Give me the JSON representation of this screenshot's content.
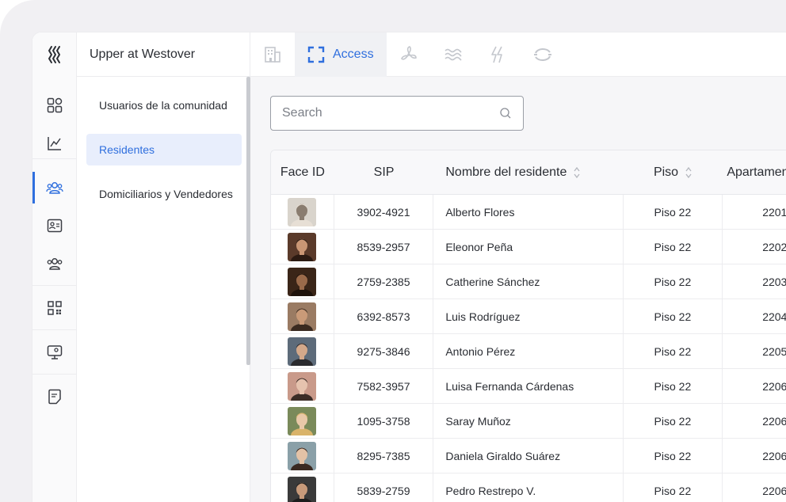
{
  "app": {
    "site_name": "Upper at Westover"
  },
  "top_tabs": [
    {
      "icon": "building-icon",
      "label": ""
    },
    {
      "icon": "scan-icon",
      "label": "Access"
    },
    {
      "icon": "fan-icon",
      "label": ""
    },
    {
      "icon": "waves-icon",
      "label": ""
    },
    {
      "icon": "bolt-icon",
      "label": ""
    },
    {
      "icon": "sync-icon",
      "label": ""
    }
  ],
  "rail": [
    "dashboard-icon",
    "chart-icon",
    "users-icon",
    "id-card-icon",
    "group-icon",
    "qr-code-icon",
    "monitor-icon",
    "note-icon"
  ],
  "subnav": [
    {
      "label": "Usuarios de la comunidad"
    },
    {
      "label": "Residentes"
    },
    {
      "label": "Domiciliarios y Vendedores"
    }
  ],
  "search": {
    "placeholder": "Search",
    "value": ""
  },
  "table": {
    "columns": [
      "Face ID",
      "SIP",
      "Nombre del residente",
      "Piso",
      "Apartamen"
    ],
    "rows": [
      {
        "sip": "3902-4921",
        "name": "Alberto Flores",
        "piso": "Piso 22",
        "apt": "2201"
      },
      {
        "sip": "8539-2957",
        "name": "Eleonor Peña",
        "piso": "Piso 22",
        "apt": "2202"
      },
      {
        "sip": "2759-2385",
        "name": "Catherine Sánchez",
        "piso": "Piso 22",
        "apt": "2203"
      },
      {
        "sip": "6392-8573",
        "name": "Luis Rodríguez",
        "piso": "Piso 22",
        "apt": "2204"
      },
      {
        "sip": "9275-3846",
        "name": "Antonio Pérez",
        "piso": "Piso 22",
        "apt": "2205"
      },
      {
        "sip": "7582-3957",
        "name": "Luisa Fernanda Cárdenas",
        "piso": "Piso 22",
        "apt": "2206"
      },
      {
        "sip": "1095-3758",
        "name": "Saray Muñoz",
        "piso": "Piso 22",
        "apt": "2206"
      },
      {
        "sip": "8295-7385",
        "name": "Daniela Giraldo Suárez",
        "piso": "Piso 22",
        "apt": "2206"
      },
      {
        "sip": "5839-2759",
        "name": "Pedro Restrepo V.",
        "piso": "Piso 22",
        "apt": "2206"
      }
    ]
  },
  "colors": {
    "accent": "#2f6fde",
    "active_bg": "#e8eefc"
  }
}
